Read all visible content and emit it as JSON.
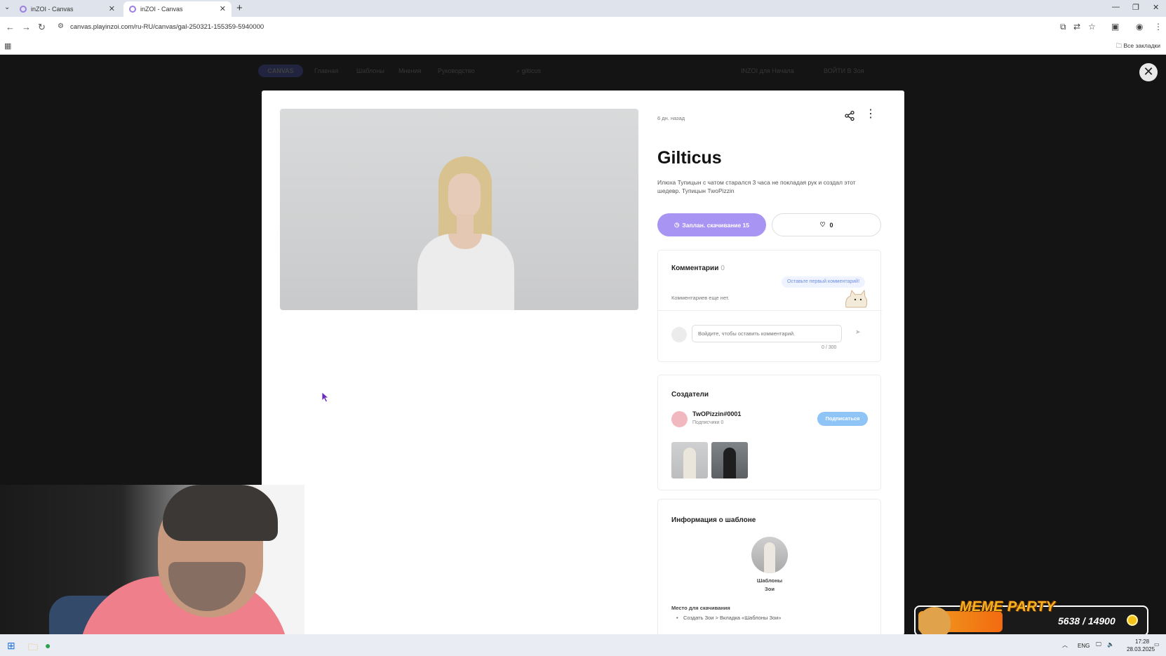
{
  "browser": {
    "tabs": [
      {
        "label": "inZOI - Canvas",
        "active": false
      },
      {
        "label": "inZOI - Canvas",
        "active": true
      }
    ],
    "url": "canvas.playinzoi.com/ru-RU/canvas/gal-250321-155359-5940000",
    "bookmarks_all_label": "Все закладки"
  },
  "site_nav": {
    "search_text": "gilticus",
    "right_link": "INZOI для Начала",
    "login": "ВОЙТИ В Зоя"
  },
  "post": {
    "time_ago": "6 дн. назад",
    "title": "Gilticus",
    "description": "Илюха Тупицын с чатом старался 3 часа не покладая рук и создал этот шедевр. Тупицын TwoPizzin",
    "download_button": "Заплан. скачивание 15",
    "likes": "0"
  },
  "comments": {
    "heading": "Комментарии",
    "count": "0",
    "first_comment_bubble": "Оставьте первый комментарий!",
    "empty_text": "Комментариев еще нет.",
    "input_placeholder": "Войдите, чтобы оставить комментарий.",
    "counter": "0 / 300"
  },
  "creators": {
    "heading": "Создатели",
    "name": "TwOPizzin#0001",
    "subscribers": "Подписчики 0",
    "follow_button": "Подписаться"
  },
  "template_info": {
    "heading": "Информация о шаблоне",
    "label_line1": "Шаблоны",
    "label_line2": "Зои",
    "download_place_heading": "Место для скачивания",
    "download_place_value": "Создать Зои > Вкладка «Шаблоны Зои»"
  },
  "overlay": {
    "meme_title": "MEME PARTY",
    "meme_score": "5638 / 14900",
    "meme_progress": 0.378
  },
  "taskbar": {
    "lang": "ENG",
    "time": "17:28",
    "date": "28.03.2025"
  },
  "colors": {
    "accent_purple": "#a894f3",
    "follow_blue": "#8fc4f7",
    "meme_orange": "#f5b321"
  }
}
